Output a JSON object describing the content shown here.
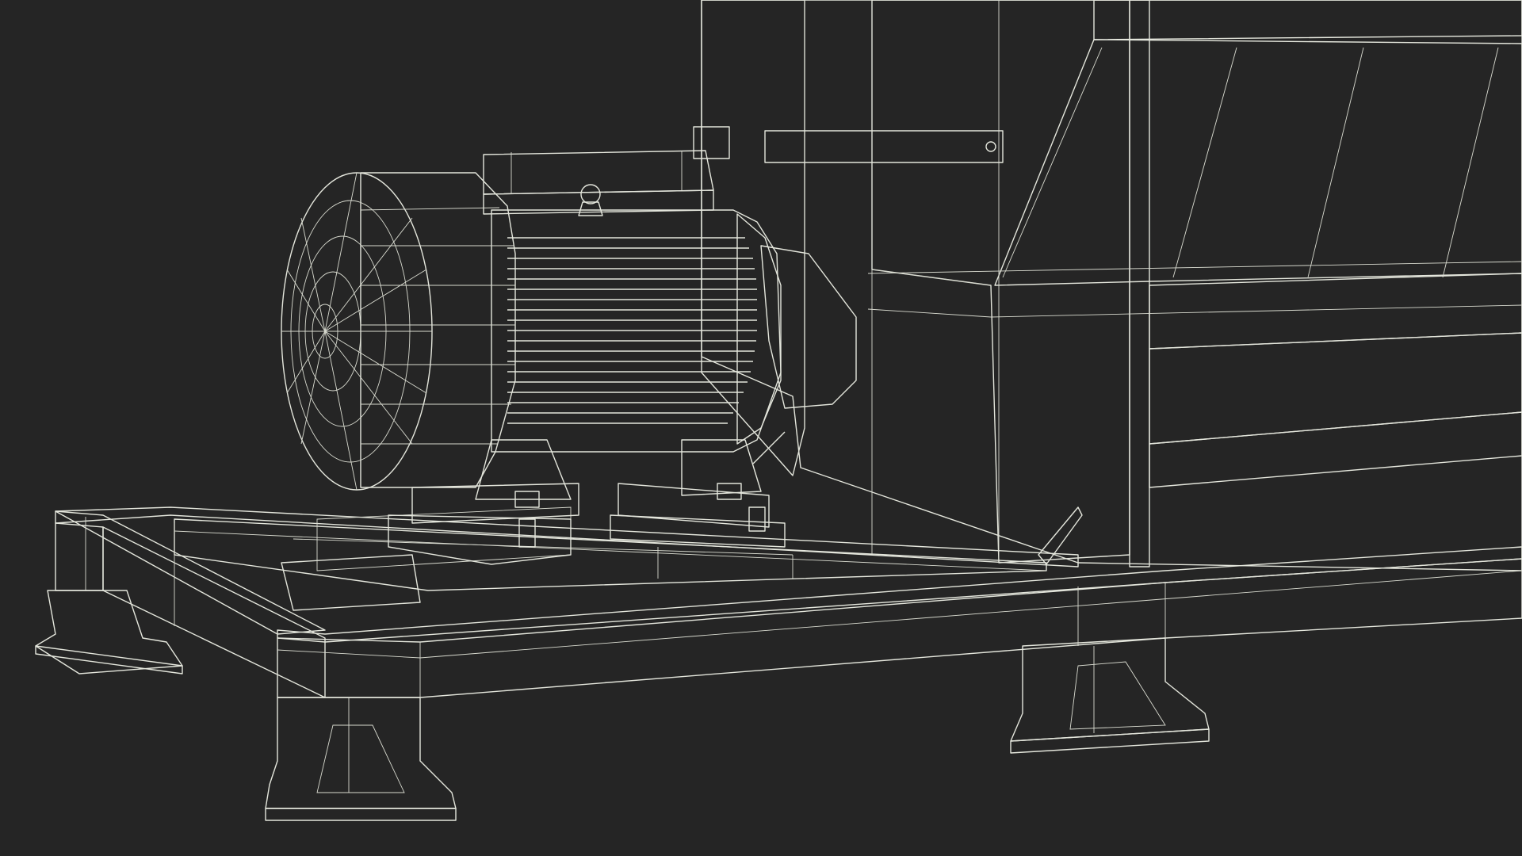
{
  "scene": {
    "subject": "wireframe-render",
    "colors": {
      "background": "#252525",
      "surface": "#7c7d70",
      "surface_dark": "#5f6055",
      "surface_light": "#8d8e81",
      "wire": "#e4e6dc"
    }
  }
}
